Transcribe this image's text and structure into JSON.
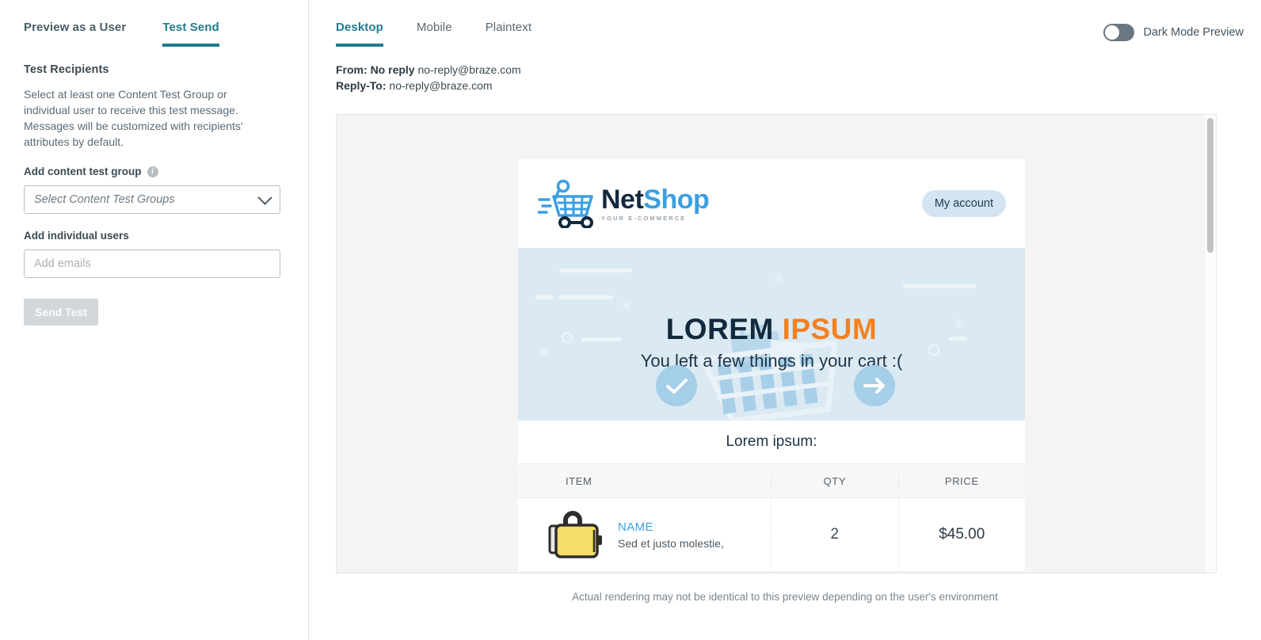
{
  "left_panel": {
    "tabs": [
      {
        "label": "Preview as a User",
        "active": false
      },
      {
        "label": "Test Send",
        "active": true
      }
    ],
    "section_title": "Test Recipients",
    "description": "Select at least one Content Test Group or individual user to receive this test message. Messages will be customized with recipients' attributes by default.",
    "content_test_group": {
      "label": "Add content test group",
      "info_icon": "info-icon",
      "placeholder": "Select Content Test Groups",
      "value": ""
    },
    "individual_users": {
      "label": "Add individual users",
      "placeholder": "Add emails",
      "value": ""
    },
    "send_button": "Send Test"
  },
  "right_panel": {
    "tabs": [
      {
        "label": "Desktop",
        "active": true
      },
      {
        "label": "Mobile",
        "active": false
      },
      {
        "label": "Plaintext",
        "active": false
      }
    ],
    "dark_mode": {
      "label": "Dark Mode Preview",
      "enabled": false
    },
    "from_label": "From:",
    "from_name": "No reply",
    "from_email": "no-reply@braze.com",
    "reply_to_label": "Reply-To:",
    "reply_to_email": "no-reply@braze.com",
    "footer_note": "Actual rendering may not be identical to this preview depending on the user's environment"
  },
  "email": {
    "brand": {
      "name_dark": "Net",
      "name_blue": "Shop",
      "tagline": "YOUR E-COMMERCE",
      "logo_icon": "shopping-cart-icon"
    },
    "account_button": "My account",
    "hero": {
      "title_dark": "LOREM",
      "title_orange": "IPSUM",
      "subtitle": "You left a few things in your cart :(",
      "badge_check": "check-icon",
      "badge_arrow": "arrow-right-icon"
    },
    "lorem_heading": "Lorem ipsum:",
    "table": {
      "columns": [
        "ITEM",
        "QTY",
        "PRICE"
      ],
      "rows": [
        {
          "thumbnail": "yellow-bag-image",
          "name": "NAME",
          "description": "Sed et justo molestie,",
          "qty": "2",
          "price": "$45.00"
        }
      ]
    }
  },
  "colors": {
    "accent_teal": "#217b8f",
    "brand_blue": "#3b9fe0",
    "brand_navy": "#13293d",
    "hero_bg": "#dae9f2",
    "orange": "#f4811f",
    "toggle_off": "#6a7680"
  }
}
